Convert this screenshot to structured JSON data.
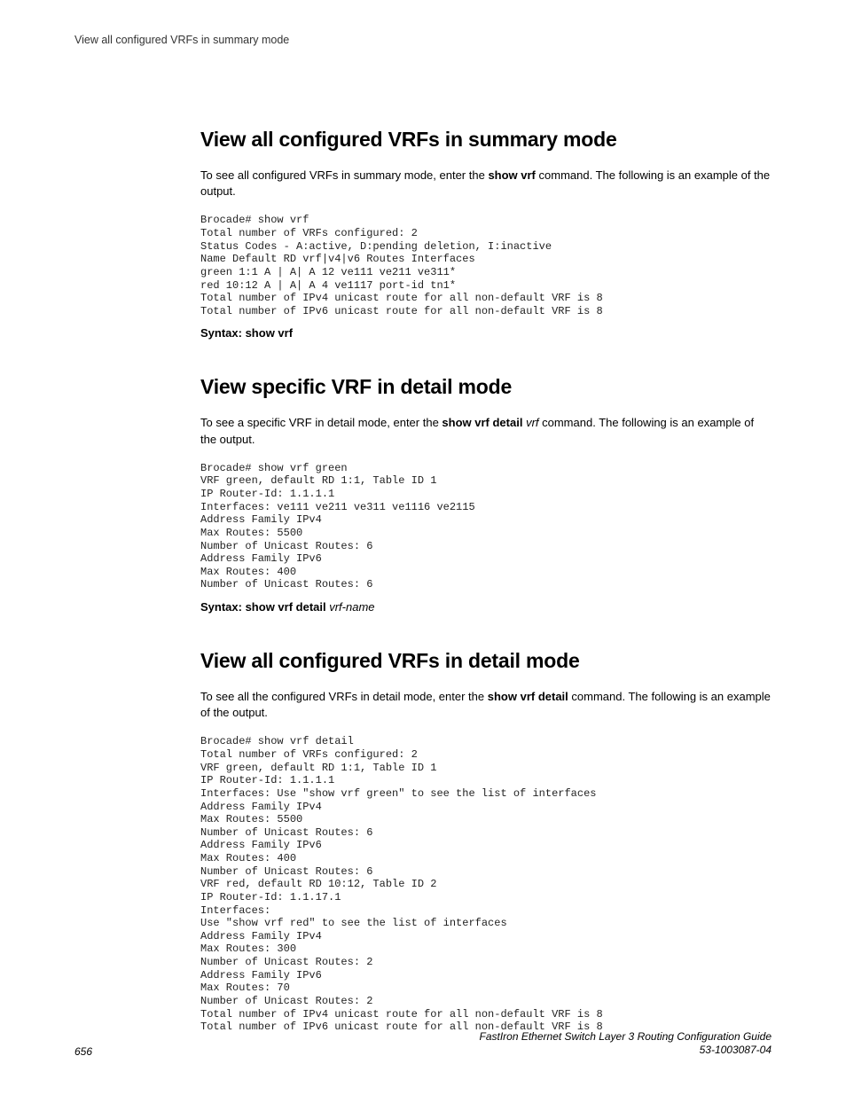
{
  "header": {
    "running_title": "View all configured VRFs in summary mode"
  },
  "sections": [
    {
      "heading": "View all configured VRFs in summary mode",
      "intro_pre": "To see all configured VRFs in summary mode, enter the ",
      "intro_bold": "show vrf",
      "intro_post": " command. The following is an example of the output.",
      "code": "Brocade# show vrf\nTotal number of VRFs configured: 2\nStatus Codes - A:active, D:pending deletion, I:inactive\nName Default RD vrf|v4|v6 Routes Interfaces\ngreen 1:1 A | A| A 12 ve111 ve211 ve311*\nred 10:12 A | A| A 4 ve1117 port-id tn1*\nTotal number of IPv4 unicast route for all non-default VRF is 8\nTotal number of IPv6 unicast route for all non-default VRF is 8",
      "syntax_label": "Syntax: ",
      "syntax_bold": "show vrf",
      "syntax_ital": ""
    },
    {
      "heading": "View specific VRF in detail mode",
      "intro_pre": "To see a specific VRF in detail mode, enter the ",
      "intro_bold": "show vrf detail",
      "intro_post_ital": " vrf",
      "intro_post": " command. The following is an example of the output.",
      "code": "Brocade# show vrf green\nVRF green, default RD 1:1, Table ID 1\nIP Router-Id: 1.1.1.1\nInterfaces: ve111 ve211 ve311 ve1116 ve2115\nAddress Family IPv4\nMax Routes: 5500\nNumber of Unicast Routes: 6\nAddress Family IPv6\nMax Routes: 400\nNumber of Unicast Routes: 6",
      "syntax_label": "Syntax: ",
      "syntax_bold": "show vrf detail",
      "syntax_ital": " vrf-name"
    },
    {
      "heading": "View all configured VRFs in detail mode",
      "intro_pre": "To see all the configured VRFs in detail mode, enter the ",
      "intro_bold": "show vrf detail",
      "intro_post": " command. The following is an example of the output.",
      "code": "Brocade# show vrf detail\nTotal number of VRFs configured: 2\nVRF green, default RD 1:1, Table ID 1\nIP Router-Id: 1.1.1.1\nInterfaces: Use \"show vrf green\" to see the list of interfaces\nAddress Family IPv4\nMax Routes: 5500\nNumber of Unicast Routes: 6\nAddress Family IPv6\nMax Routes: 400\nNumber of Unicast Routes: 6\nVRF red, default RD 10:12, Table ID 2\nIP Router-Id: 1.1.17.1\nInterfaces:\nUse \"show vrf red\" to see the list of interfaces\nAddress Family IPv4\nMax Routes: 300\nNumber of Unicast Routes: 2\nAddress Family IPv6\nMax Routes: 70\nNumber of Unicast Routes: 2\nTotal number of IPv4 unicast route for all non-default VRF is 8\nTotal number of IPv6 unicast route for all non-default VRF is 8",
      "syntax_label": "",
      "syntax_bold": "",
      "syntax_ital": ""
    }
  ],
  "footer": {
    "page_number": "656",
    "doc_title": "FastIron Ethernet Switch Layer 3 Routing Configuration Guide",
    "doc_number": "53-1003087-04"
  }
}
